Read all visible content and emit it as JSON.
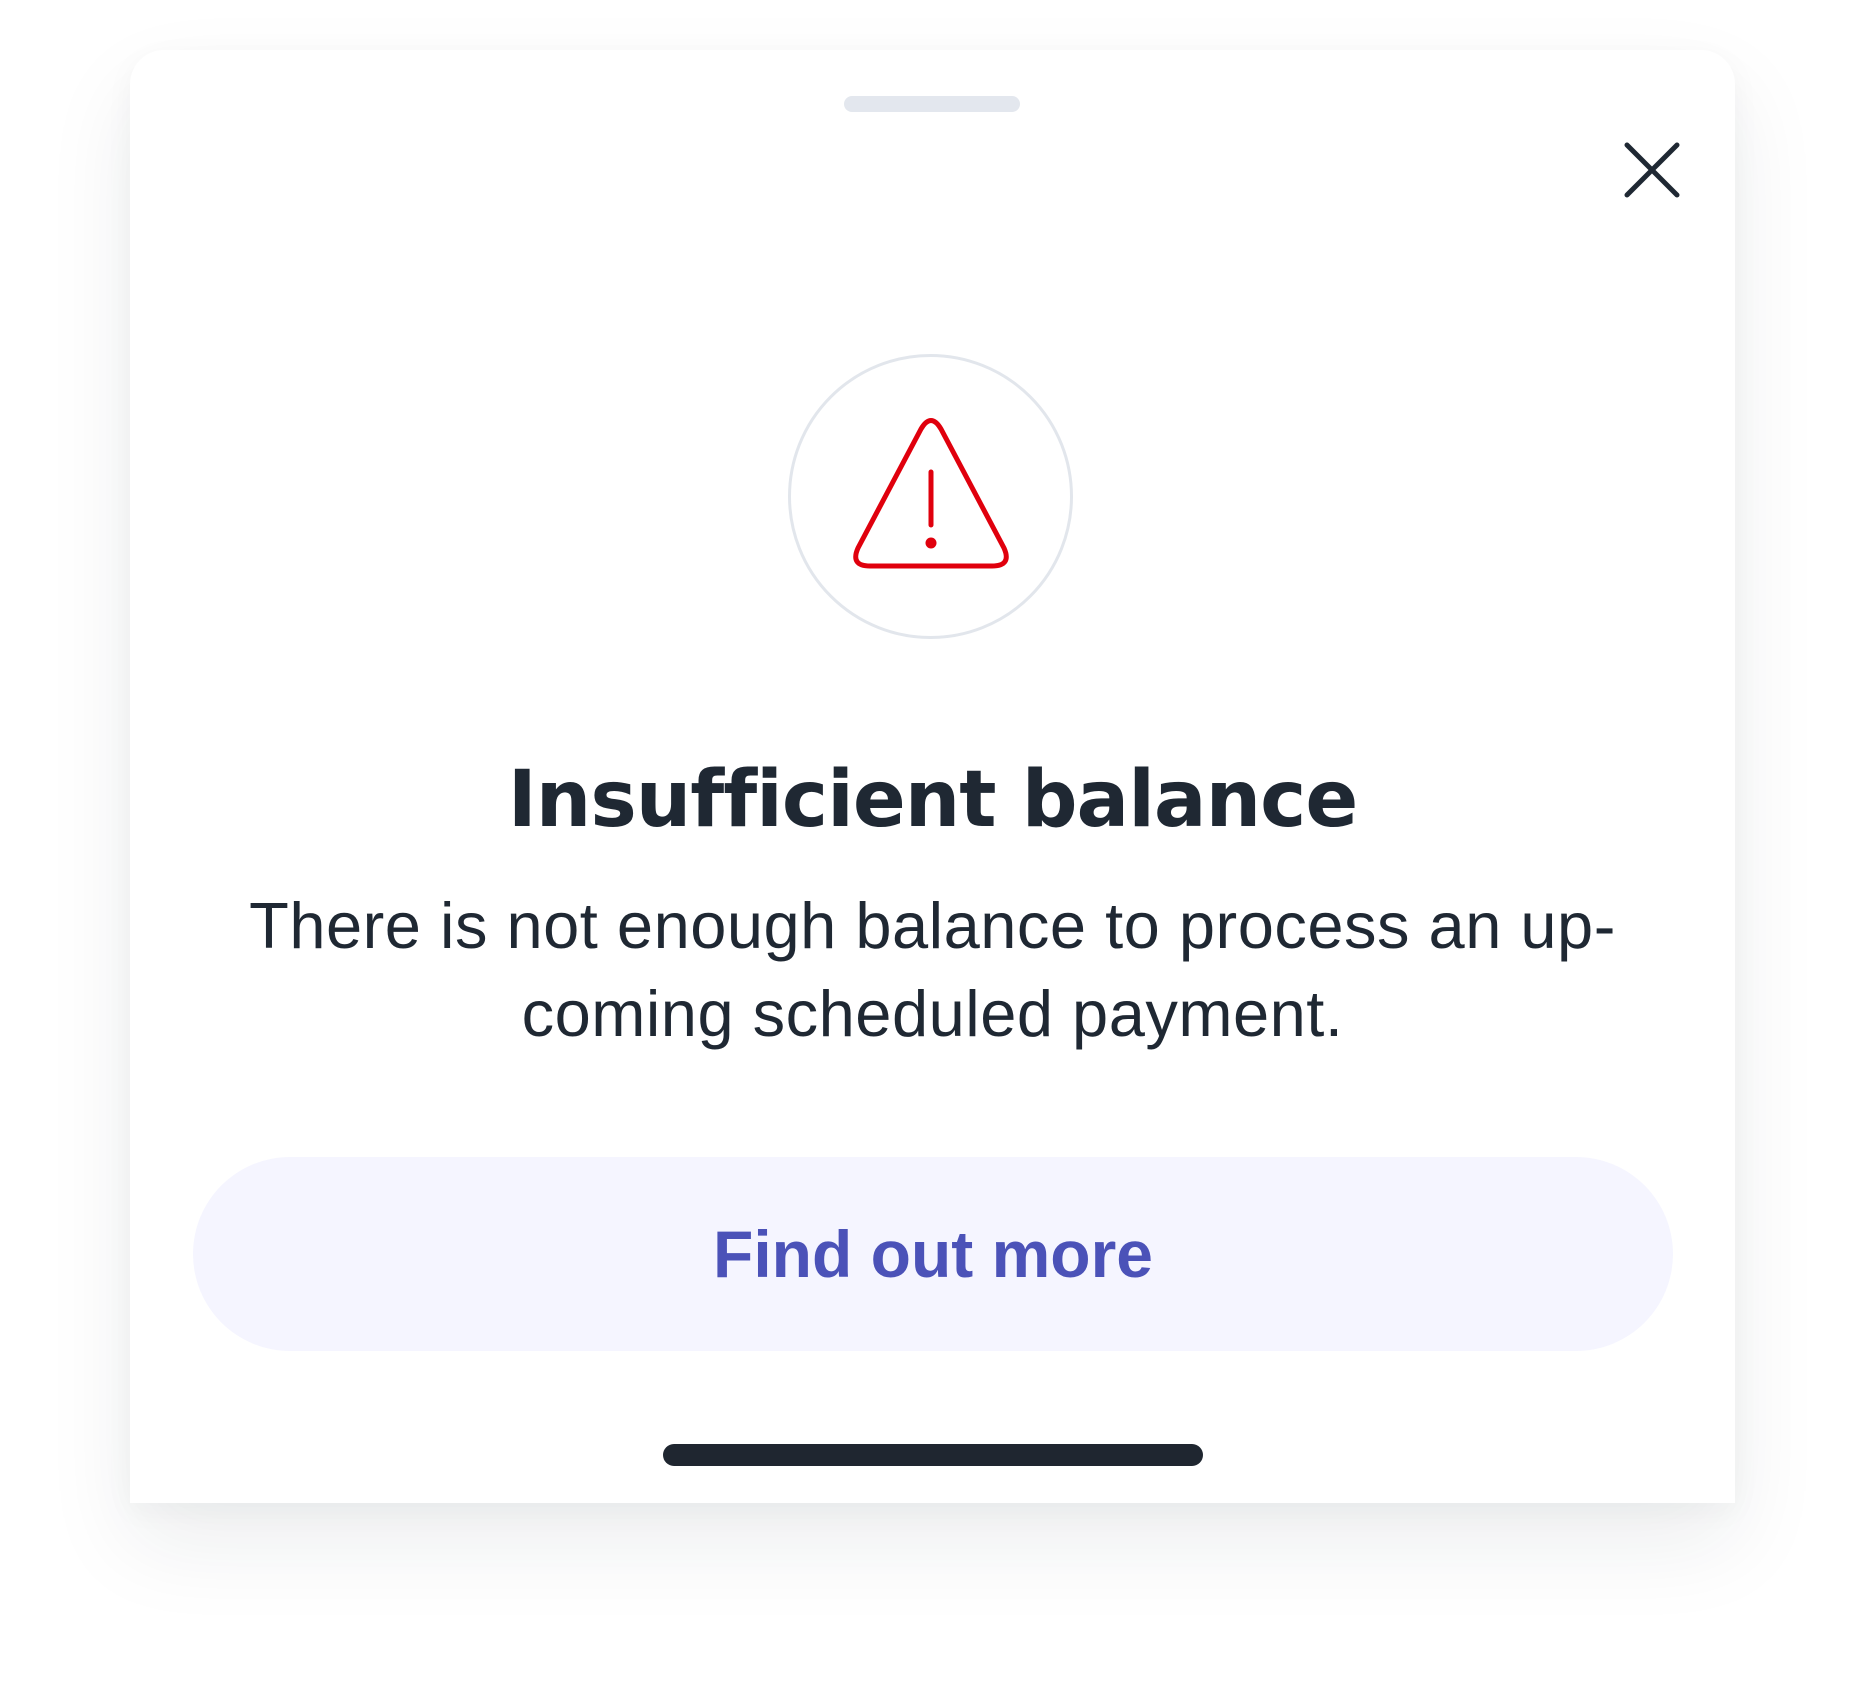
{
  "sheet": {
    "close_icon": "close-icon",
    "alert_icon": "warning-triangle-icon",
    "title": "Insufficient balance",
    "message": "There is not enough balance to process an up-coming scheduled payment.",
    "cta_label": "Find out more"
  },
  "colors": {
    "alert": "#e0000d",
    "text": "#1f2833",
    "cta_text": "#4b52b8",
    "cta_background": "#f5f5ff",
    "circle_border": "#e2e6ec"
  }
}
